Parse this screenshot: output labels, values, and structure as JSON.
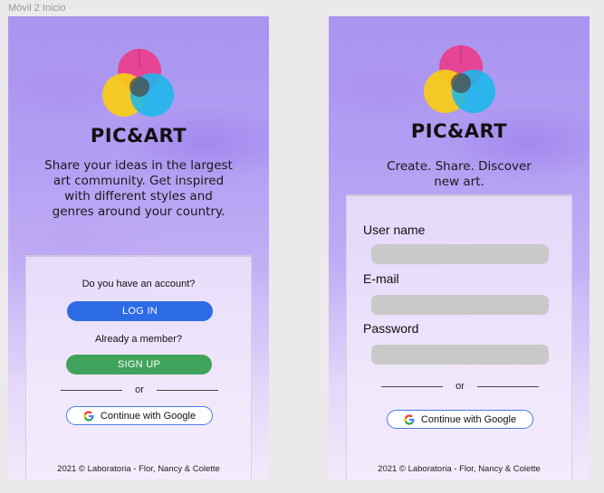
{
  "frame_label": "Móvil 2 Inicio",
  "brand": "PIC&ART",
  "colors": {
    "magenta": "#e9408f",
    "yellow": "#f7cd16",
    "cyan": "#1ab7ea",
    "login_blue": "#2b6be5",
    "signup_green": "#3fa35c",
    "input_gray": "#c9c9c9"
  },
  "screen1": {
    "tagline": "Share your ideas in the largest art community. Get inspired with different styles and genres around your country.",
    "account_question": "Do you have an account?",
    "login_label": "LOG IN",
    "member_question": "Already a member?",
    "signup_label": "SIGN UP",
    "or": "or",
    "google_label": "Continue with Google",
    "footer": "2021 © Laboratoria - Flor, Nancy & Colette"
  },
  "screen2": {
    "tagline": "Create. Share. Discover new art.",
    "username_label": "User name",
    "username_value": "",
    "email_label": "E-mail",
    "email_value": "",
    "password_label": "Password",
    "password_value": "",
    "or": "or",
    "google_label": "Continue with Google",
    "footer": "2021 © Laboratoria - Flor, Nancy & Colette"
  }
}
